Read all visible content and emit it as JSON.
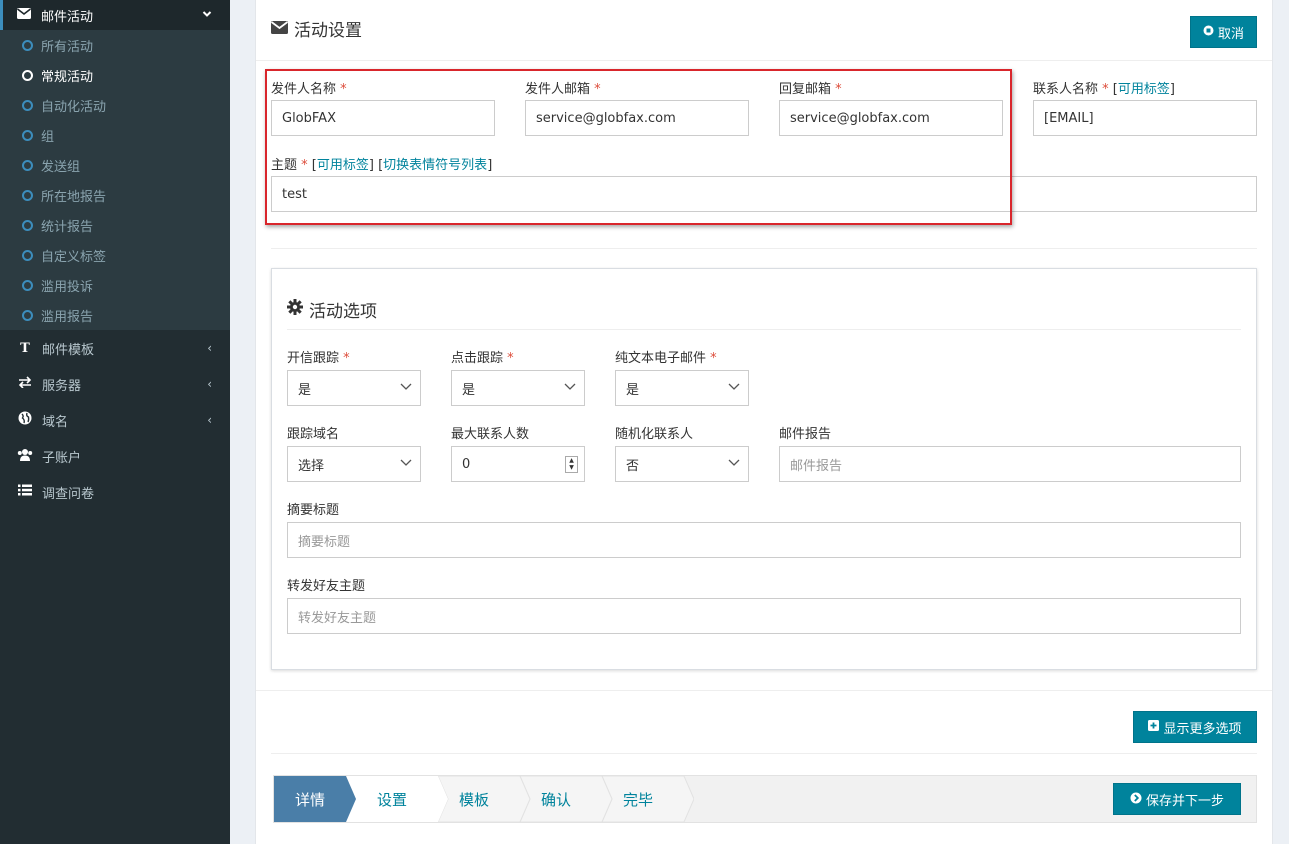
{
  "sidebar": {
    "section": {
      "label": "邮件活动",
      "icon": "envelope-icon"
    },
    "sub_items": [
      {
        "label": "所有活动"
      },
      {
        "label": "常规活动",
        "active": true
      },
      {
        "label": "自动化活动"
      },
      {
        "label": "组"
      },
      {
        "label": "发送组"
      },
      {
        "label": "所在地报告"
      },
      {
        "label": "统计报告"
      },
      {
        "label": "自定义标签"
      },
      {
        "label": "滥用投诉"
      },
      {
        "label": "滥用报告"
      }
    ],
    "items": [
      {
        "label": "邮件模板",
        "icon": "text-icon",
        "caret": "‹"
      },
      {
        "label": "服务器",
        "icon": "exchange-icon",
        "caret": "‹"
      },
      {
        "label": "域名",
        "icon": "globe-icon",
        "caret": "‹"
      },
      {
        "label": "子账户",
        "icon": "users-icon"
      },
      {
        "label": "调查问卷",
        "icon": "list-icon"
      }
    ]
  },
  "header": {
    "title": "活动设置",
    "cancel_label": "取消"
  },
  "form": {
    "sender_name": {
      "label": "发件人名称",
      "required": "*",
      "value": "GlobFAX"
    },
    "sender_email": {
      "label": "发件人邮箱",
      "required": "*",
      "value": "service@globfax.com"
    },
    "reply_email": {
      "label": "回复邮箱",
      "required": "*",
      "value": "service@globfax.com"
    },
    "contact_name": {
      "label": "联系人名称",
      "required": "*",
      "link": "可用标签",
      "value": "[EMAIL]"
    },
    "subject": {
      "label": "主题",
      "required": "*",
      "link1": "可用标签",
      "link2": "切换表情符号列表",
      "value": "test"
    }
  },
  "options": {
    "title": "活动选项",
    "open_tracking": {
      "label": "开信跟踪",
      "required": "*",
      "value": "是"
    },
    "click_tracking": {
      "label": "点击跟踪",
      "required": "*",
      "value": "是"
    },
    "plain_text": {
      "label": "纯文本电子邮件",
      "required": "*",
      "value": "是"
    },
    "tracking_domain": {
      "label": "跟踪域名",
      "value": "选择"
    },
    "max_contacts": {
      "label": "最大联系人数",
      "value": "0"
    },
    "randomize": {
      "label": "随机化联系人",
      "value": "否"
    },
    "mail_report": {
      "label": "邮件报告",
      "placeholder": "邮件报告"
    },
    "summary_title": {
      "label": "摘要标题",
      "placeholder": "摘要标题"
    },
    "forward_subject": {
      "label": "转发好友主题",
      "placeholder": "转发好友主题"
    }
  },
  "more_options_label": "显示更多选项",
  "steps": [
    "详情",
    "设置",
    "模板",
    "确认",
    "完毕"
  ],
  "save_next_label": "保存并下一步",
  "colors": {
    "accent": "#00839c",
    "sidebar_bg": "#222d32",
    "highlight": "#d9262c"
  }
}
